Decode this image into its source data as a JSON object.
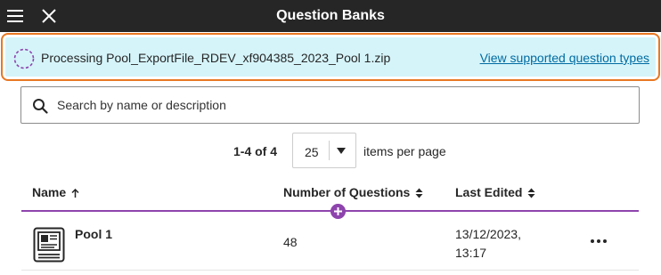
{
  "header": {
    "title": "Question Banks"
  },
  "banner": {
    "processing_text": "Processing Pool_ExportFile_RDEV_xf904385_2023_Pool 1.zip",
    "link_text": "View supported question types",
    "border_color": "#e87722",
    "background_color": "#d5f4fa"
  },
  "search": {
    "placeholder": "Search by name or description",
    "value": ""
  },
  "pagination": {
    "range_text": "1-4 of 4",
    "per_page_value": "25",
    "per_page_label": "items per page"
  },
  "table": {
    "columns": {
      "name": "Name",
      "questions": "Number of Questions",
      "last_edited": "Last Edited"
    },
    "rows": [
      {
        "name": "Pool 1",
        "question_count": "48",
        "last_edited_date": "13/12/2023,",
        "last_edited_time": "13:17"
      }
    ]
  },
  "colors": {
    "topbar": "#262626",
    "accent_purple": "#8e44ad",
    "link_blue": "#006ba1"
  },
  "icons": [
    "menu-icon",
    "close-icon",
    "spinner-icon",
    "search-icon",
    "sort-up-icon",
    "sort-updown-icon",
    "add-icon",
    "question-pool-icon",
    "more-options-icon",
    "caret-down-icon"
  ]
}
